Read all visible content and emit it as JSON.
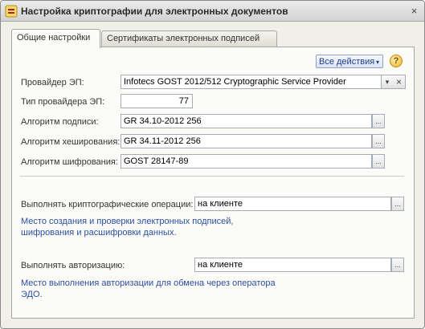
{
  "window": {
    "title": "Настройка криптографии для электронных документов",
    "close_glyph": "×"
  },
  "tabs": [
    {
      "label": "Общие настройки",
      "active": true
    },
    {
      "label": "Сертификаты электронных подписей",
      "active": false
    }
  ],
  "toolbar": {
    "all_actions_label": "Все действия",
    "all_actions_arrow": "▾",
    "help_glyph": "?"
  },
  "form": {
    "provider": {
      "label": "Провайдер ЭП:",
      "value": "Infotecs GOST 2012/512 Cryptographic Service Provider",
      "dropdown_glyph": "▾",
      "clear_glyph": "×"
    },
    "provider_type": {
      "label": "Тип провайдера ЭП:",
      "value": "77"
    },
    "sign_algorithm": {
      "label": "Алгоритм подписи:",
      "value": "GR 34.10-2012 256",
      "select_glyph": "..."
    },
    "hash_algorithm": {
      "label": "Алгоритм хеширования:",
      "value": "GR 34.11-2012 256",
      "select_glyph": "..."
    },
    "encrypt_algorithm": {
      "label": "Алгоритм шифрования:",
      "value": "GOST 28147-89",
      "select_glyph": "..."
    },
    "crypto_ops": {
      "label": "Выполнять криптографические операции:",
      "value": "на клиенте",
      "select_glyph": "...",
      "hint_line1": "Место создания и проверки электронных подписей,",
      "hint_line2": "шифрования и расшифровки данных."
    },
    "authorization": {
      "label": "Выполнять авторизацию:",
      "value": "на клиенте",
      "select_glyph": "...",
      "hint_line1": "Место выполнения авторизации для обмена через оператора",
      "hint_line2": "ЭДО."
    }
  },
  "colors": {
    "hint_text": "#2c4fa2",
    "action_button_text": "#1d3c8c"
  }
}
